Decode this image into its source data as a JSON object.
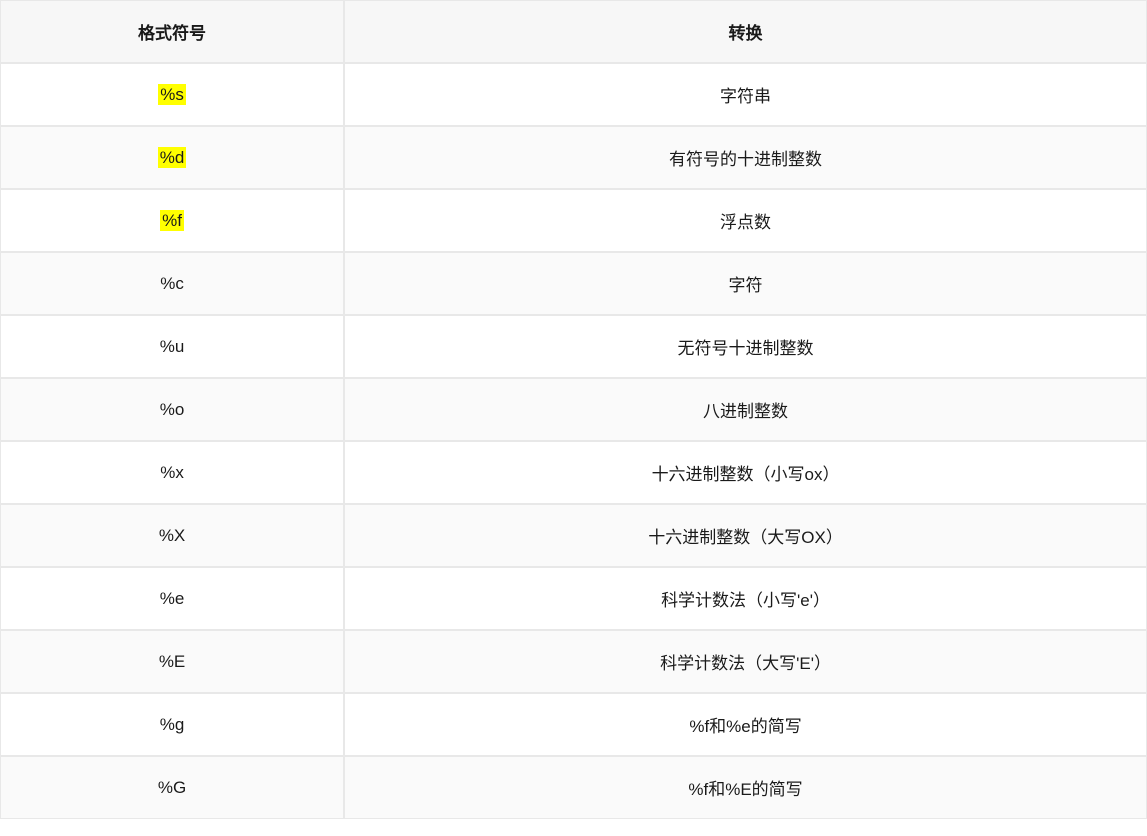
{
  "headers": {
    "symbol": "格式符号",
    "conversion": "转换"
  },
  "rows": [
    {
      "symbol": "%s",
      "desc": "字符串",
      "highlight": true
    },
    {
      "symbol": "%d",
      "desc": "有符号的十进制整数",
      "highlight": true
    },
    {
      "symbol": "%f",
      "desc": "浮点数",
      "highlight": true
    },
    {
      "symbol": "%c",
      "desc": "字符",
      "highlight": false
    },
    {
      "symbol": "%u",
      "desc": "无符号十进制整数",
      "highlight": false
    },
    {
      "symbol": "%o",
      "desc": "八进制整数",
      "highlight": false
    },
    {
      "symbol": "%x",
      "desc": "十六进制整数（小写ox）",
      "highlight": false
    },
    {
      "symbol": "%X",
      "desc": "十六进制整数（大写OX）",
      "highlight": false
    },
    {
      "symbol": "%e",
      "desc": "科学计数法（小写'e'）",
      "highlight": false
    },
    {
      "symbol": "%E",
      "desc": "科学计数法（大写'E'）",
      "highlight": false
    },
    {
      "symbol": "%g",
      "desc": "%f和%e的简写",
      "highlight": false
    },
    {
      "symbol": "%G",
      "desc": "%f和%E的简写",
      "highlight": false
    }
  ]
}
